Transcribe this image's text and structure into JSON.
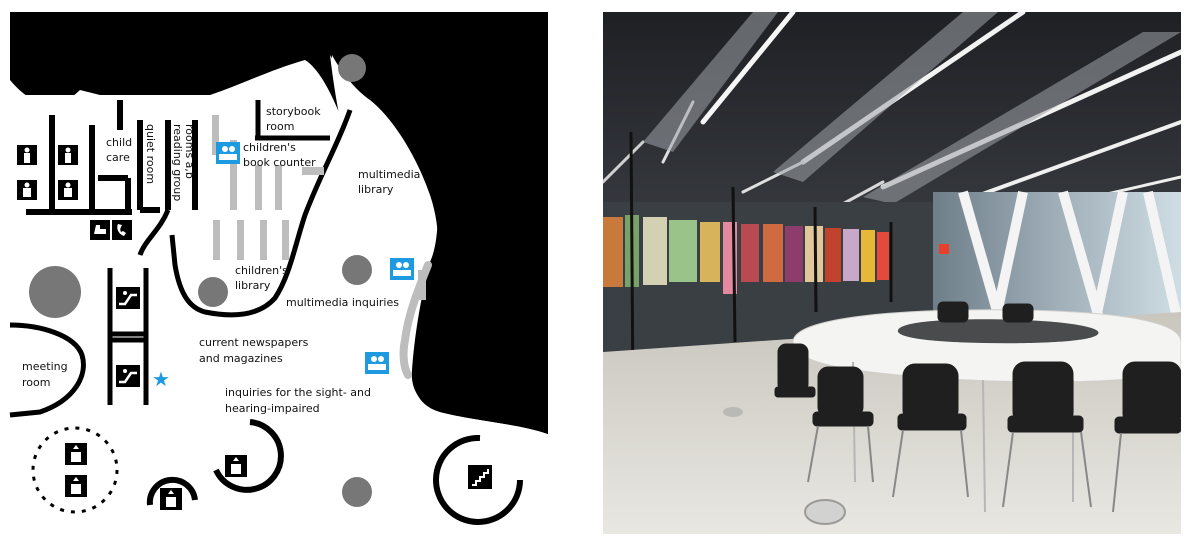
{
  "floorplan": {
    "labels": {
      "storybook_room_1": "storybook",
      "storybook_room_2": "room",
      "child_care_1": "child",
      "child_care_2": "care",
      "quiet_room": "quiet room",
      "reading_group_1": "reading group",
      "reading_group_2": "rooms a,b",
      "childrens_book_counter_1": "children's",
      "childrens_book_counter_2": "book counter",
      "multimedia_library_1": "multimedia",
      "multimedia_library_2": "library",
      "childrens_library_1": "children's",
      "childrens_library_2": "library",
      "multimedia_inquiries": "multimedia inquiries",
      "current_newspapers_1": "current newspapers",
      "current_newspapers_2": "and magazines",
      "meeting_room_1": "meeting",
      "meeting_room_2": "room",
      "sight_hearing_1": "inquiries for the sight- and",
      "sight_hearing_2": "hearing-impaired"
    },
    "icons": [
      "toilet-men-icon",
      "toilet-men-icon",
      "toilet-accessible-icon",
      "toilet-accessible-icon",
      "baby-changing-icon",
      "telephone-icon",
      "information-desk-icon",
      "escalator-icon",
      "elevator-icon",
      "stairs-icon",
      "star-icon"
    ],
    "colors": {
      "wall": "#000000",
      "info_blue": "#1e9be0",
      "column_gray": "#777777",
      "shelf_gray": "#bdbdbd"
    }
  },
  "photo": {
    "subject": "reading-room-interior",
    "colors": {
      "ceiling": "#2a2c2f",
      "floor": "#d9d6cf",
      "table": "#f4f4f2",
      "chair": "#1f1f1f"
    }
  }
}
